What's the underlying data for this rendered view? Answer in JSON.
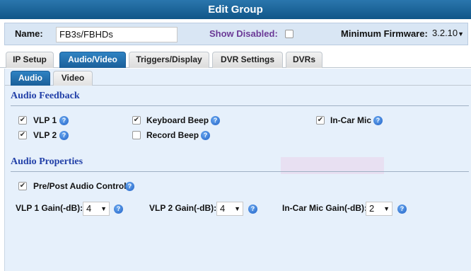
{
  "window": {
    "title": "Edit Group"
  },
  "header": {
    "name_label": "Name:",
    "name_value": "FB3s/FBHDs",
    "show_disabled_label": "Show Disabled:",
    "show_disabled_checked": false,
    "min_firmware_label": "Minimum Firmware:",
    "min_firmware_value": "3.2.10"
  },
  "tabs": [
    {
      "label": "IP Setup",
      "active": false
    },
    {
      "label": "Audio/Video",
      "active": true
    },
    {
      "label": "Triggers/Display",
      "active": false
    },
    {
      "label": "DVR Settings",
      "active": false
    },
    {
      "label": "DVRs",
      "active": false
    }
  ],
  "subtabs": [
    {
      "label": "Audio",
      "active": true
    },
    {
      "label": "Video",
      "active": false
    }
  ],
  "audio_feedback": {
    "title": "Audio Feedback",
    "items": [
      {
        "label": "VLP 1",
        "checked": true
      },
      {
        "label": "Keyboard Beep",
        "checked": true
      },
      {
        "label": "In-Car Mic",
        "checked": true
      },
      {
        "label": "VLP 2",
        "checked": true
      },
      {
        "label": "Record Beep",
        "checked": false
      }
    ]
  },
  "audio_properties": {
    "title": "Audio Properties",
    "pre_post_label": "Pre/Post Audio Control",
    "pre_post_checked": true,
    "gains": [
      {
        "label": "VLP 1 Gain(-dB):",
        "value": "4"
      },
      {
        "label": "VLP 2 Gain(-dB):",
        "value": "4"
      },
      {
        "label": "In-Car Mic Gain(-dB):",
        "value": "2"
      }
    ]
  },
  "icons": {
    "help": "help-icon",
    "check": "✔",
    "dropdown": "▼",
    "help_glyph": "?"
  },
  "colors": {
    "title_bar": "#115688",
    "active_tab": "#1a5f99",
    "section_title": "#2240a8",
    "panel_bg": "#e6f0fb"
  }
}
